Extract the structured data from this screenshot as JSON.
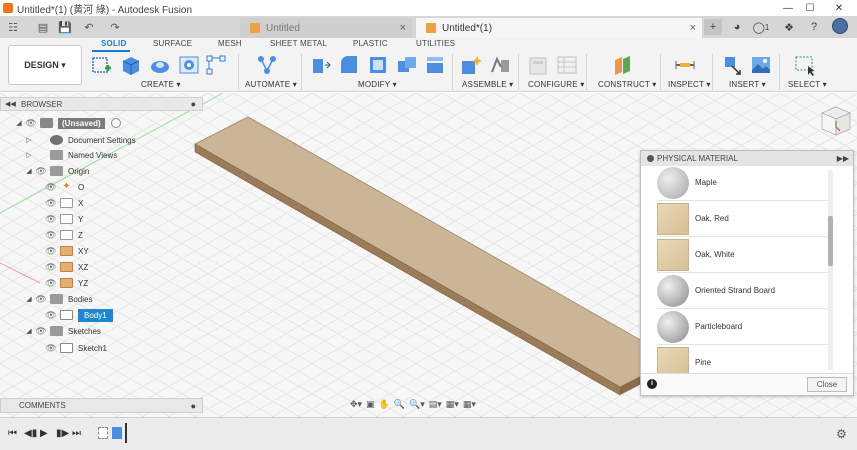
{
  "window": {
    "title": "Untitled*(1) (黄河 綠) - Autodesk Fusion",
    "minimize": "—",
    "maximize": "☐",
    "close": "✕"
  },
  "tabs": [
    {
      "label": "Untitled",
      "active": false
    },
    {
      "label": "Untitled*(1)",
      "active": true
    }
  ],
  "tab_close": "×",
  "notification_count": "1",
  "ribbon": {
    "workspace": "DESIGN",
    "tabs": [
      "SOLID",
      "SURFACE",
      "MESH",
      "SHEET METAL",
      "PLASTIC",
      "UTILITIES"
    ],
    "groups": [
      "CREATE",
      "AUTOMATE",
      "MODIFY",
      "ASSEMBLE",
      "CONFIGURE",
      "CONSTRUCT",
      "INSPECT",
      "INSERT",
      "SELECT"
    ]
  },
  "browser": {
    "title": "BROWSER",
    "root": "(Unsaved)",
    "items": [
      {
        "label": "Document Settings"
      },
      {
        "label": "Named Views"
      },
      {
        "label": "Origin"
      },
      {
        "label": "O"
      },
      {
        "label": "X"
      },
      {
        "label": "Y"
      },
      {
        "label": "Z"
      },
      {
        "label": "XY"
      },
      {
        "label": "XZ"
      },
      {
        "label": "YZ"
      },
      {
        "label": "Bodies"
      },
      {
        "label": "Body1"
      },
      {
        "label": "Sketches"
      },
      {
        "label": "Sketch1"
      }
    ]
  },
  "comments": {
    "title": "COMMENTS"
  },
  "material_panel": {
    "title": "PHYSICAL MATERIAL",
    "items": [
      {
        "label": "Maple",
        "swatch": "sphere"
      },
      {
        "label": "Oak, Red",
        "swatch": "wood"
      },
      {
        "label": "Oak, White",
        "swatch": "wood"
      },
      {
        "label": "Oriented Strand Board",
        "swatch": "sphere"
      },
      {
        "label": "Particleboard",
        "swatch": "sphere"
      },
      {
        "label": "Pine",
        "swatch": "wood"
      }
    ],
    "close_label": "Close"
  },
  "colors": {
    "accent": "#1f78d1",
    "board_top": "#cbb597",
    "board_side": "#9b7b58"
  }
}
